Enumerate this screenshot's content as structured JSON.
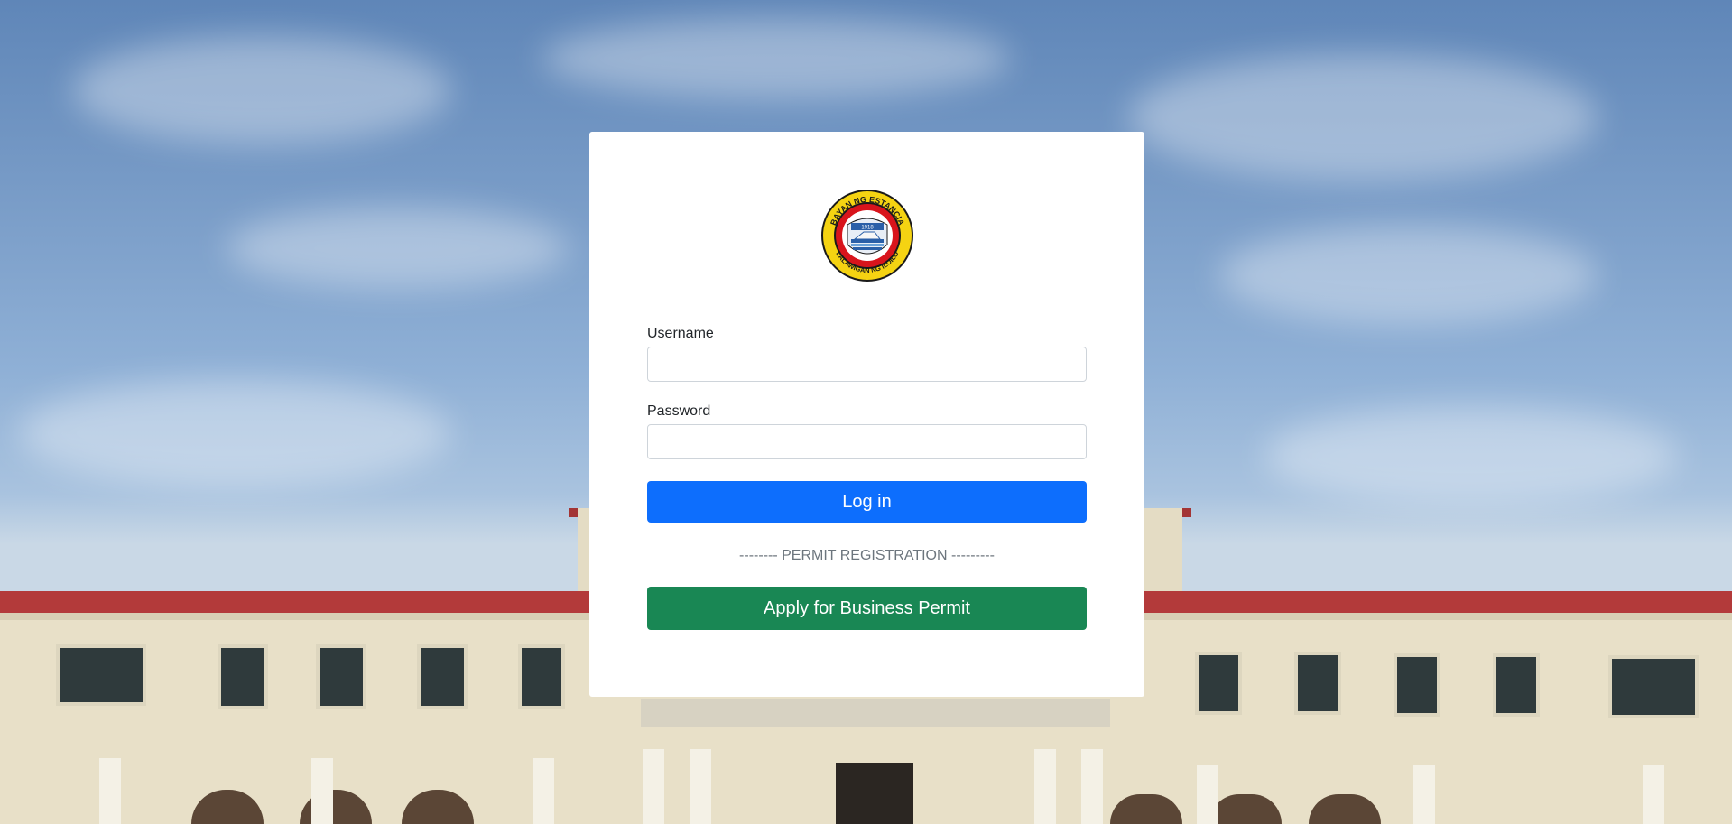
{
  "logo": {
    "top_text": "BAYAN NG ESTANCIA",
    "bottom_text": "LALAWIGAN NG ILOILO",
    "year": "1918",
    "icon": "municipal-seal-icon"
  },
  "login_form": {
    "username_label": "Username",
    "username_value": "",
    "password_label": "Password",
    "password_value": "",
    "login_button": "Log in"
  },
  "permit": {
    "divider_text": "-------- PERMIT REGISTRATION ---------",
    "apply_button": "Apply for Business Permit"
  },
  "colors": {
    "primary": "#0d6efd",
    "success": "#198754",
    "muted": "#6c757d",
    "seal_red": "#d8141c",
    "seal_yellow": "#f5d312"
  }
}
